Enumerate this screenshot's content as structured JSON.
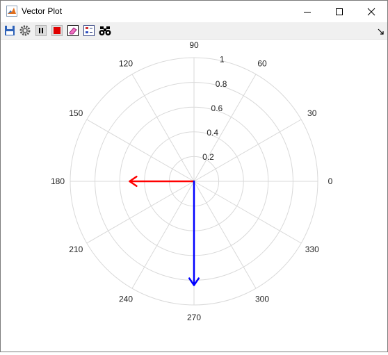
{
  "window": {
    "title": "Vector Plot",
    "controls": [
      "minimize",
      "maximize",
      "close"
    ]
  },
  "toolbar": {
    "buttons": [
      {
        "name": "save",
        "icon": "floppy-disk-icon"
      },
      {
        "name": "settings",
        "icon": "gear-icon"
      },
      {
        "name": "pause",
        "icon": "pause-icon"
      },
      {
        "name": "stop",
        "icon": "stop-icon"
      },
      {
        "name": "clear",
        "icon": "eraser-icon"
      },
      {
        "name": "legend",
        "icon": "legend-icon"
      },
      {
        "name": "find",
        "icon": "binoculars-icon"
      }
    ],
    "dock_icon": "undock-arrow-icon"
  },
  "chart_data": {
    "type": "polar",
    "angle_ticks": [
      "0",
      "30",
      "60",
      "90",
      "120",
      "150",
      "180",
      "210",
      "240",
      "270",
      "300",
      "330"
    ],
    "radial_ticks": [
      "0.2",
      "0.4",
      "0.6",
      "0.8",
      "1"
    ],
    "rlim": [
      0,
      1
    ],
    "grid": true,
    "series": [
      {
        "angle": 180,
        "magnitude": 0.52,
        "color": "#ff0000"
      },
      {
        "angle": 270,
        "magnitude": 0.84,
        "color": "#0000ff"
      }
    ],
    "grid_color": "#d9d9d9"
  }
}
